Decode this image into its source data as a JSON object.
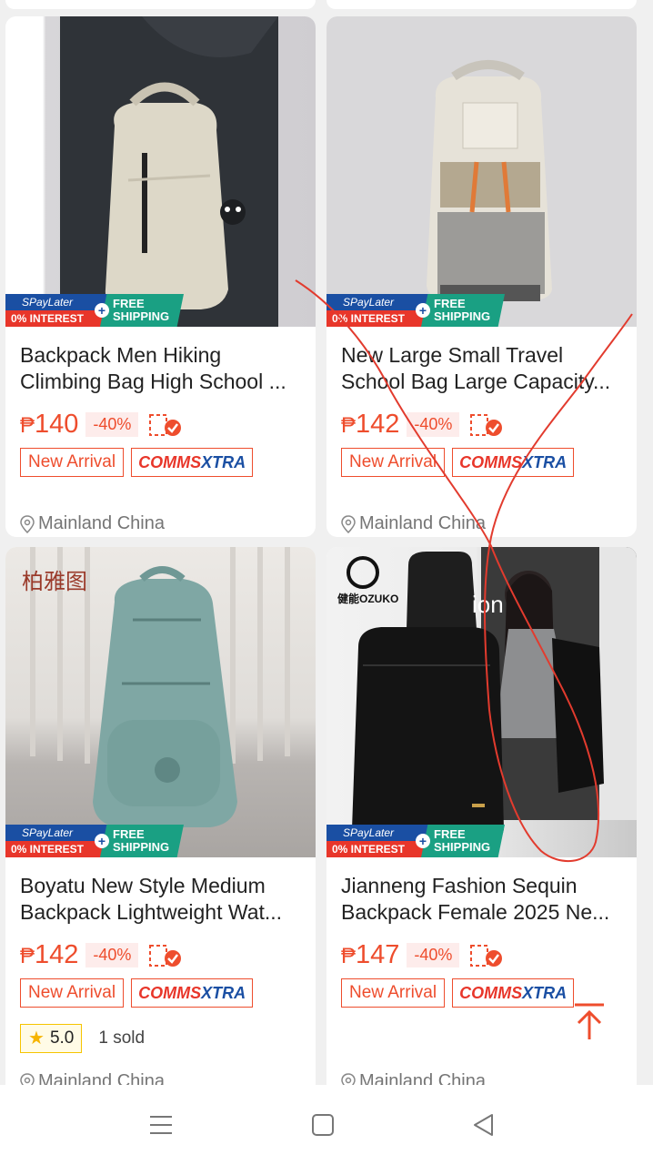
{
  "products": [
    {
      "title_line1": "Backpack Men Hiking",
      "title_line2": "Climbing Bag High School ...",
      "currency": "₱",
      "price": "140",
      "discount": "-40%",
      "tag_new": "New Arrival",
      "tag_comms_a": "COMMS",
      "tag_comms_b": "XTRA",
      "location": "Mainland China"
    },
    {
      "title_line1": "New Large Small Travel",
      "title_line2": "School Bag Large Capacity...",
      "currency": "₱",
      "price": "142",
      "discount": "-40%",
      "tag_new": "New Arrival",
      "tag_comms_a": "COMMS",
      "tag_comms_b": "XTRA",
      "location": "Mainland China"
    },
    {
      "title_line1": "Boyatu New Style Medium",
      "title_line2": "Backpack Lightweight Wat...",
      "currency": "₱",
      "price": "142",
      "discount": "-40%",
      "tag_new": "New Arrival",
      "tag_comms_a": "COMMS",
      "tag_comms_b": "XTRA",
      "rating": "5.0",
      "sold": "1 sold",
      "location": "Mainland China"
    },
    {
      "title_line1": "Jianneng Fashion Sequin",
      "title_line2": "Backpack Female 2025 Ne...",
      "currency": "₱",
      "price": "147",
      "discount": "-40%",
      "tag_new": "New Arrival",
      "tag_comms_a": "COMMS",
      "tag_comms_b": "XTRA",
      "location": "Mainland China",
      "image_text_brand": "健能OZUKO",
      "image_text_fashion": "ion"
    }
  ],
  "promo_badge": {
    "spaylater": "SPayLater",
    "interest": "0% INTEREST",
    "free_line1": "FREE",
    "free_line2": "SHIPPING"
  },
  "image_logo_text": "柏雅图",
  "icons": {
    "back_to_top": "arrow-up-to-top-icon",
    "nav_menu": "menu-icon",
    "nav_home": "square-home-icon",
    "nav_back": "triangle-back-icon",
    "location": "location-pin-icon",
    "coins": "coins-check-icon",
    "star": "star-icon"
  },
  "colors": {
    "accent": "#ee4d2d",
    "spaylater_blue": "#1a4fa3",
    "free_shipping_green": "#1aa083",
    "scribble_red": "#e23b2e"
  }
}
